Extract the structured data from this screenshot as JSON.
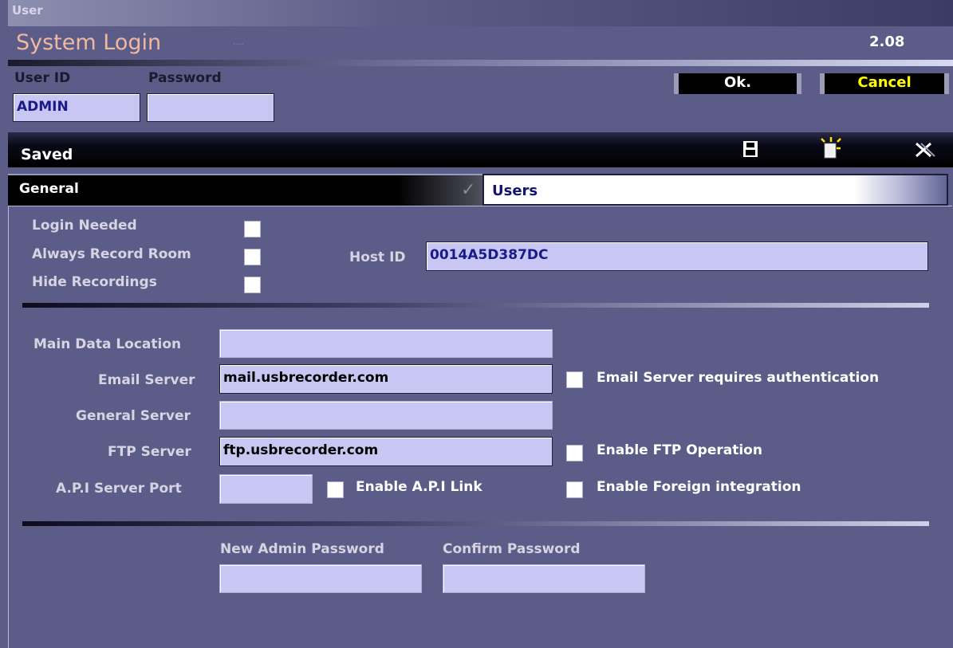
{
  "window": {
    "app_name": "User",
    "title": "System Login",
    "title_dots": "....",
    "version": "2.08"
  },
  "login": {
    "user_id_label": "User ID",
    "password_label": "Password",
    "user_id_value": "ADMIN",
    "password_value": "",
    "ok_label": "Ok.",
    "cancel_label": "Cancel"
  },
  "status_bar": {
    "status_text": "Saved",
    "icons": [
      "save-icon",
      "new-document-icon",
      "delete-icon"
    ]
  },
  "tabs": [
    {
      "label": "General",
      "active": true
    },
    {
      "label": "Users",
      "active": false
    }
  ],
  "general": {
    "login_needed_label": "Login Needed",
    "always_record_label": "Always Record Room",
    "hide_recordings_label": "Hide Recordings",
    "host_id_label": "Host ID",
    "host_id_value": "0014A5D387DC",
    "main_data_label": "Main Data Location",
    "main_data_value": "",
    "email_server_label": "Email Server",
    "email_server_value": "mail.usbrecorder.com",
    "email_auth_label": "Email Server requires authentication",
    "general_server_label": "General Server",
    "general_server_value": "",
    "ftp_server_label": "FTP Server",
    "ftp_server_value": "ftp.usbrecorder.com",
    "enable_ftp_label": "Enable FTP Operation",
    "api_port_label": "A.P.I Server Port",
    "api_port_value": "",
    "enable_api_label": "Enable A.P.I Link",
    "enable_foreign_label": "Enable Foreign integration",
    "new_admin_pw_label": "New Admin Password",
    "confirm_pw_label": "Confirm Password"
  },
  "colors": {
    "background": "#5b5d88",
    "field": "#c8c6f2",
    "title_text": "#f0b8a0",
    "cancel_text": "#ffff00"
  }
}
